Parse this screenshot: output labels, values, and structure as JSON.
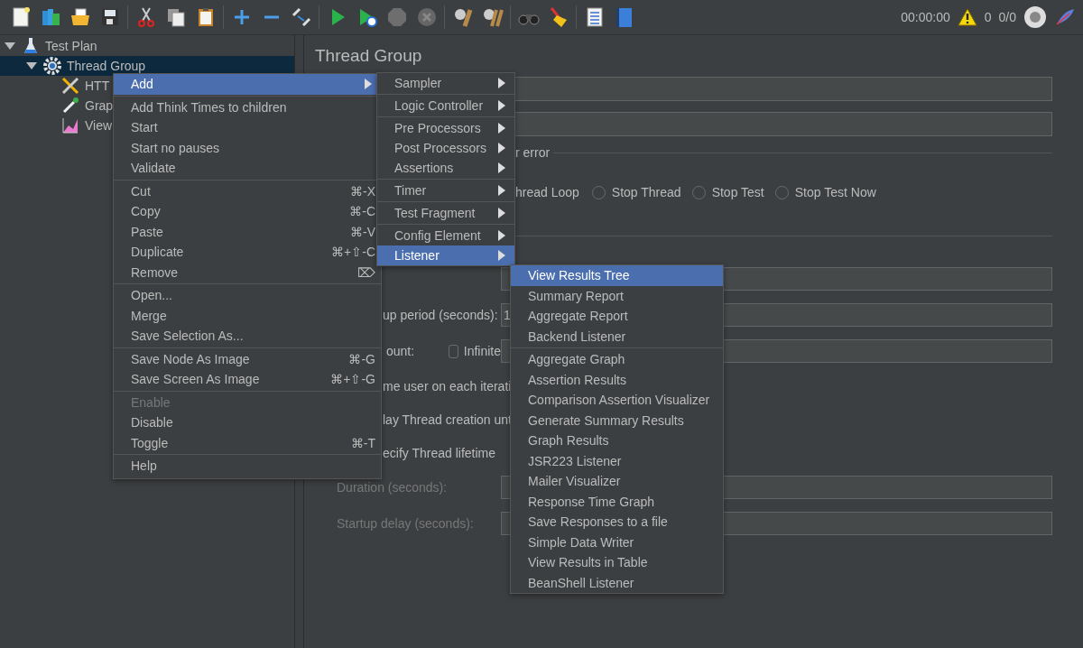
{
  "toolbar": {
    "timer": "00:00:00",
    "warnings": "0",
    "threads": "0/0"
  },
  "tree": [
    {
      "label": "Test Plan",
      "kind": "plan",
      "expanded": true,
      "selected": false,
      "children": [
        {
          "label": "Thread Group",
          "kind": "group",
          "expanded": true,
          "selected": true,
          "children": [
            {
              "label": "HTT",
              "kind": "sampler",
              "selected": false
            },
            {
              "label": "Grap",
              "kind": "config",
              "selected": false
            },
            {
              "label": "View",
              "kind": "listener",
              "selected": false
            }
          ]
        }
      ]
    }
  ],
  "panel": {
    "title": "Thread Group",
    "error_label": "r error",
    "partial_option": "hread Loop",
    "options": [
      {
        "label": "Stop Thread",
        "selected": false
      },
      {
        "label": "Stop Test",
        "selected": false
      },
      {
        "label": "Stop Test Now",
        "selected": false
      }
    ],
    "rows": [
      {
        "kind": "field"
      },
      {
        "kind": "partial_field",
        "label": "up period (seconds):",
        "value": "1"
      },
      {
        "kind": "loop",
        "label": "ount:",
        "checkbox_label": "Infinite",
        "checked": false
      },
      {
        "kind": "text",
        "label": "me user on each iterati"
      },
      {
        "kind": "text",
        "label": "lay Thread creation unt"
      },
      {
        "kind": "text",
        "label": "ecify Thread lifetime"
      },
      {
        "kind": "field",
        "label": "Duration (seconds):",
        "disabled": true
      },
      {
        "kind": "field",
        "label": "Startup delay (seconds):",
        "disabled": true
      }
    ]
  },
  "context_menu": [
    [
      {
        "label": "Add",
        "kind": "submenu",
        "selected": true,
        "disabled": false
      }
    ],
    [
      {
        "label": "Add Think Times to children",
        "kind": "command",
        "selected": false,
        "disabled": false
      },
      {
        "label": "Start",
        "kind": "command",
        "selected": false,
        "disabled": false
      },
      {
        "label": "Start no pauses",
        "kind": "command",
        "selected": false,
        "disabled": false
      },
      {
        "label": "Validate",
        "kind": "command",
        "selected": false,
        "disabled": false
      }
    ],
    [
      {
        "label": "Cut",
        "kind": "command",
        "shortcut": "⌘-X",
        "selected": false,
        "disabled": false
      },
      {
        "label": "Copy",
        "kind": "command",
        "shortcut": "⌘-C",
        "selected": false,
        "disabled": false
      },
      {
        "label": "Paste",
        "kind": "command",
        "shortcut": "⌘-V",
        "selected": false,
        "disabled": false
      },
      {
        "label": "Duplicate",
        "kind": "command",
        "shortcut": "⌘+⇧-C",
        "selected": false,
        "disabled": false
      },
      {
        "label": "Remove",
        "kind": "command",
        "shortcut": "⌦",
        "selected": false,
        "disabled": false
      }
    ],
    [
      {
        "label": "Open...",
        "kind": "command",
        "selected": false,
        "disabled": false
      },
      {
        "label": "Merge",
        "kind": "command",
        "selected": false,
        "disabled": false
      },
      {
        "label": "Save Selection As...",
        "kind": "command",
        "selected": false,
        "disabled": false
      }
    ],
    [
      {
        "label": "Save Node As Image",
        "kind": "command",
        "shortcut": "⌘-G",
        "selected": false,
        "disabled": false
      },
      {
        "label": "Save Screen As Image",
        "kind": "command",
        "shortcut": "⌘+⇧-G",
        "selected": false,
        "disabled": false
      }
    ],
    [
      {
        "label": "Enable",
        "kind": "command",
        "selected": false,
        "disabled": true
      },
      {
        "label": "Disable",
        "kind": "command",
        "selected": false,
        "disabled": false
      },
      {
        "label": "Toggle",
        "kind": "command",
        "shortcut": "⌘-T",
        "selected": false,
        "disabled": false
      }
    ],
    [
      {
        "label": "Help",
        "kind": "command",
        "selected": false,
        "disabled": false
      }
    ]
  ],
  "add_menu": [
    [
      {
        "label": "Sampler",
        "selected": false
      }
    ],
    [
      {
        "label": "Logic Controller",
        "selected": false
      }
    ],
    [
      {
        "label": "Pre Processors",
        "selected": false
      },
      {
        "label": "Post Processors",
        "selected": false
      },
      {
        "label": "Assertions",
        "selected": false
      }
    ],
    [
      {
        "label": "Timer",
        "selected": false
      }
    ],
    [
      {
        "label": "Test Fragment",
        "selected": false
      }
    ],
    [
      {
        "label": "Config Element",
        "selected": false
      },
      {
        "label": "Listener",
        "selected": true
      }
    ]
  ],
  "listener_menu": [
    [
      {
        "label": "View Results Tree",
        "selected": true
      },
      {
        "label": "Summary Report",
        "selected": false
      },
      {
        "label": "Aggregate Report",
        "selected": false
      },
      {
        "label": "Backend Listener",
        "selected": false
      }
    ],
    [
      {
        "label": "Aggregate Graph",
        "selected": false
      },
      {
        "label": "Assertion Results",
        "selected": false
      },
      {
        "label": "Comparison Assertion Visualizer",
        "selected": false
      },
      {
        "label": "Generate Summary Results",
        "selected": false
      },
      {
        "label": "Graph Results",
        "selected": false
      },
      {
        "label": "JSR223 Listener",
        "selected": false
      },
      {
        "label": "Mailer Visualizer",
        "selected": false
      },
      {
        "label": "Response Time Graph",
        "selected": false
      },
      {
        "label": "Save Responses to a file",
        "selected": false
      },
      {
        "label": "Simple Data Writer",
        "selected": false
      },
      {
        "label": "View Results in Table",
        "selected": false
      },
      {
        "label": "BeanShell Listener",
        "selected": false
      }
    ]
  ]
}
